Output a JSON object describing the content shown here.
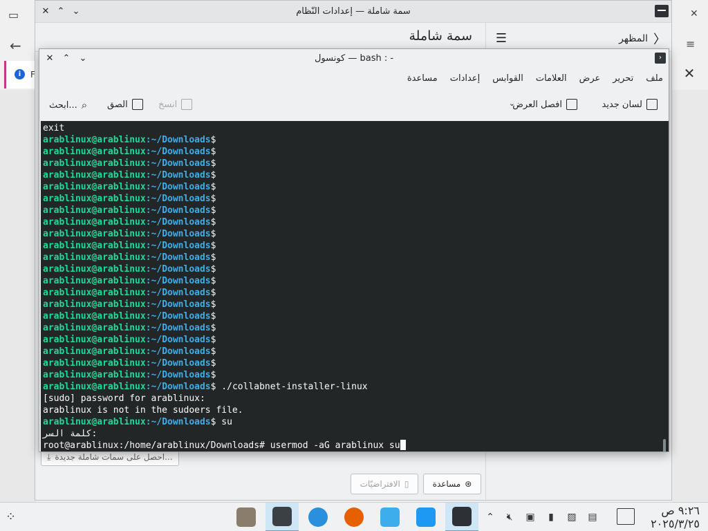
{
  "background": {
    "info_text": "F",
    "icons": [
      "inbox-icon",
      "back-arrow-icon",
      "menu-icon",
      "close-icon",
      "info-icon"
    ]
  },
  "settings": {
    "window_title": "سمة شاملة — إعدادات النّظام",
    "page_title": "سمة شاملة",
    "back_label": "المظهر",
    "get_new_label": "احصل على سمات شاملة جديدة...",
    "help_label": "مساعدة",
    "defaults_label": "الافتراضيّات"
  },
  "konsole": {
    "title": "كونسول — bash : -",
    "menu": [
      "ملف",
      "تحرير",
      "عرض",
      "العلامات",
      "القوابس",
      "إعدادات",
      "مساعدة"
    ],
    "toolbar": {
      "new_tab": "لسان جديد",
      "split_view": "افصل العرض",
      "copy": "انسخ",
      "paste": "الصق",
      "find": "ابحث..."
    },
    "terminal": {
      "user_host": "arablinux@arablinux",
      "path": ":~/Downloads",
      "prompt_symbol": "$",
      "first_line": "exit",
      "empty_prompt_count": 21,
      "cmd_installer": " ./collabnet-installer-linux",
      "sudo_prompt": "[sudo] password for arablinux:",
      "sudoers_error": "arablinux is not in the sudoers file.",
      "cmd_su": " su",
      "password_prompt": "كلمة السر:",
      "root_prompt": "root@arablinux:/home/arablinux/Downloads# ",
      "root_command": "usermod -aG arablinux su"
    }
  },
  "taskbar": {
    "clock_time": "٩:٢٦ ص",
    "clock_date": "٢٠٢٥/٣/٢٥",
    "apps": [
      "gimp-icon",
      "konsole-icon",
      "kde-connect-icon",
      "firefox-icon",
      "dolphin-icon",
      "discover-icon",
      "system-settings-icon"
    ],
    "colors": {
      "active_bg": "#cfe6f6",
      "accent": "#3daee9"
    }
  }
}
